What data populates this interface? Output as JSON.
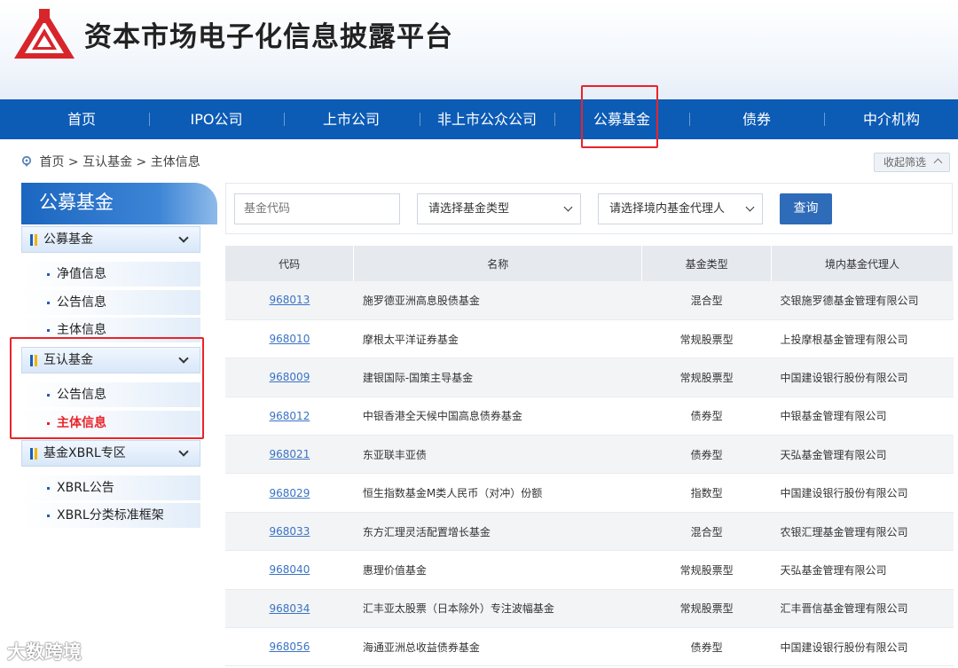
{
  "header": {
    "title": "资本市场电子化信息披露平台"
  },
  "nav": [
    {
      "label": "首页"
    },
    {
      "label": "IPO公司"
    },
    {
      "label": "上市公司"
    },
    {
      "label": "非上市公众公司"
    },
    {
      "label": "公募基金"
    },
    {
      "label": "债券"
    },
    {
      "label": "中介机构"
    }
  ],
  "breadcrumb": {
    "home": "首页",
    "sep1": ">",
    "level1": "互认基金",
    "sep2": ">",
    "level2": "主体信息"
  },
  "collapse_button": "收起筛选",
  "sidebar": {
    "title": "公募基金",
    "group1": {
      "label": "公募基金",
      "items": [
        "净值信息",
        "公告信息",
        "主体信息"
      ]
    },
    "group2": {
      "label": "互认基金",
      "items": [
        "公告信息",
        "主体信息"
      ]
    },
    "group3": {
      "label": "基金XBRL专区",
      "items": [
        "XBRL公告",
        "XBRL分类标准框架"
      ]
    }
  },
  "filters": {
    "code_placeholder": "基金代码",
    "type_select": "请选择基金类型",
    "agent_select": "请选择境内基金代理人",
    "query_button": "查询"
  },
  "table": {
    "headers": [
      "代码",
      "名称",
      "基金类型",
      "境内基金代理人"
    ],
    "rows": [
      [
        "968013",
        "施罗德亚洲高息股债基金",
        "混合型",
        "交银施罗德基金管理有限公司"
      ],
      [
        "968010",
        "摩根太平洋证券基金",
        "常规股票型",
        "上投摩根基金管理有限公司"
      ],
      [
        "968009",
        "建银国际-国策主导基金",
        "常规股票型",
        "中国建设银行股份有限公司"
      ],
      [
        "968012",
        "中银香港全天候中国高息债券基金",
        "债券型",
        "中银基金管理有限公司"
      ],
      [
        "968021",
        "东亚联丰亚债",
        "债券型",
        "天弘基金管理有限公司"
      ],
      [
        "968029",
        "恒生指数基金M类人民币（对冲）份额",
        "指数型",
        "中国建设银行股份有限公司"
      ],
      [
        "968033",
        "东方汇理灵活配置增长基金",
        "混合型",
        "农银汇理基金管理有限公司"
      ],
      [
        "968040",
        "惠理价值基金",
        "常规股票型",
        "天弘基金管理有限公司"
      ],
      [
        "968034",
        "汇丰亚太股票（日本除外）专注波幅基金",
        "常规股票型",
        "汇丰晋信基金管理有限公司"
      ],
      [
        "968056",
        "海通亚洲总收益债券基金",
        "债券型",
        "中国建设银行股份有限公司"
      ]
    ]
  },
  "watermark": "大数跨境",
  "colors": {
    "nav_bg": "#0c5bb5",
    "highlight": "#e8242a",
    "link": "#3a73c4",
    "button": "#2e6bb8"
  }
}
